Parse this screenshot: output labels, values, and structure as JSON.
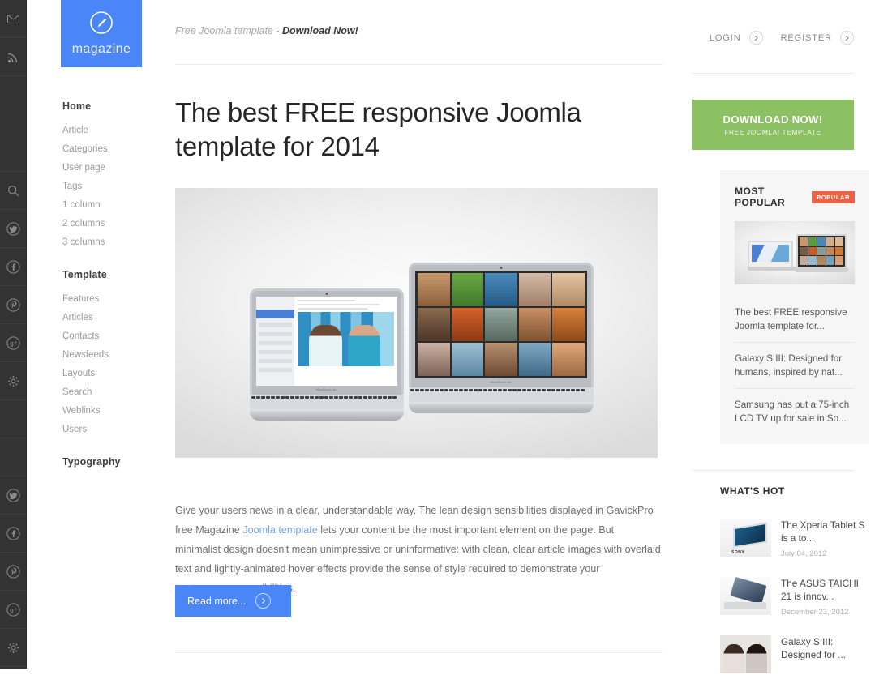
{
  "rail": {
    "icons_top": [
      "mail-icon",
      "rss-icon"
    ],
    "icons_mid": [
      "search-icon",
      "twitter-icon",
      "facebook-icon",
      "pinterest-icon",
      "googleplus-icon",
      "gear-icon"
    ],
    "icons_bottom": [
      "twitter-icon",
      "facebook-icon",
      "pinterest-icon",
      "googleplus-icon",
      "gear-icon"
    ]
  },
  "logo": {
    "text": "magazine",
    "icon": "pencil-circle-icon",
    "color": "#4a86f7"
  },
  "header": {
    "tagline_prefix": "Free Joomla template - ",
    "tagline_strong": "Download Now!",
    "login_label": "LOGIN",
    "register_label": "REGISTER"
  },
  "nav": {
    "groups": [
      {
        "heading": "Home",
        "items": [
          "Article",
          "Categories",
          "User page",
          "Tags",
          "1 column",
          "2 columns",
          "3 columns"
        ]
      },
      {
        "heading": "Template",
        "items": [
          "Features",
          "Articles",
          "Contacts",
          "Newsfeeds",
          "Layouts",
          "Search",
          "Weblinks",
          "Users"
        ]
      },
      {
        "heading": "Typography",
        "items": []
      }
    ]
  },
  "article": {
    "title": "The best FREE responsive Joomla template for 2014",
    "hero_alt": "two-macbook-air-laptops",
    "body_part1": "Give your users news in a clear, understandable way. The lean design sensibilities displayed in GavickPro free Magazine ",
    "body_link": "Joomla template",
    "body_part2": " lets your content be the most important element on the page. But minimalist design doesn't mean unimpressive or uninformative: with clean, clear article images with overlaid text and lightly-animated hover effects provide the sense of style required to demonstrate your contemporary sensibilities.",
    "read_more_label": "Read more...",
    "link_color": "#74a4e8"
  },
  "sidebar": {
    "download": {
      "line1": "DOWNLOAD NOW!",
      "line2": "FREE JOOMLA! TEMPLATE",
      "color": "#8cc163"
    },
    "most_popular": {
      "title": "MOST POPULAR",
      "badge": "POPULAR",
      "badge_color": "#ec6243",
      "thumb_alt": "two-laptops-thumbnail",
      "items": [
        "The best FREE responsive Joomla template for...",
        "Galaxy S III: Designed for humans, inspired by nat...",
        "Samsung has put a 75-inch LCD TV up for sale in So..."
      ]
    },
    "whats_hot": {
      "title": "WHAT'S HOT",
      "items": [
        {
          "title": "The Xperia Tablet S is a to...",
          "date": "July 04, 2012",
          "thumb": "sony-tablet-thumbnail"
        },
        {
          "title": "The ASUS TAICHI 21 is innov...",
          "date": "December 23, 2012",
          "thumb": "asus-laptop-thumbnail"
        },
        {
          "title": "Galaxy S III: Designed for ...",
          "date": "",
          "thumb": "two-women-thumbnail"
        }
      ]
    }
  }
}
